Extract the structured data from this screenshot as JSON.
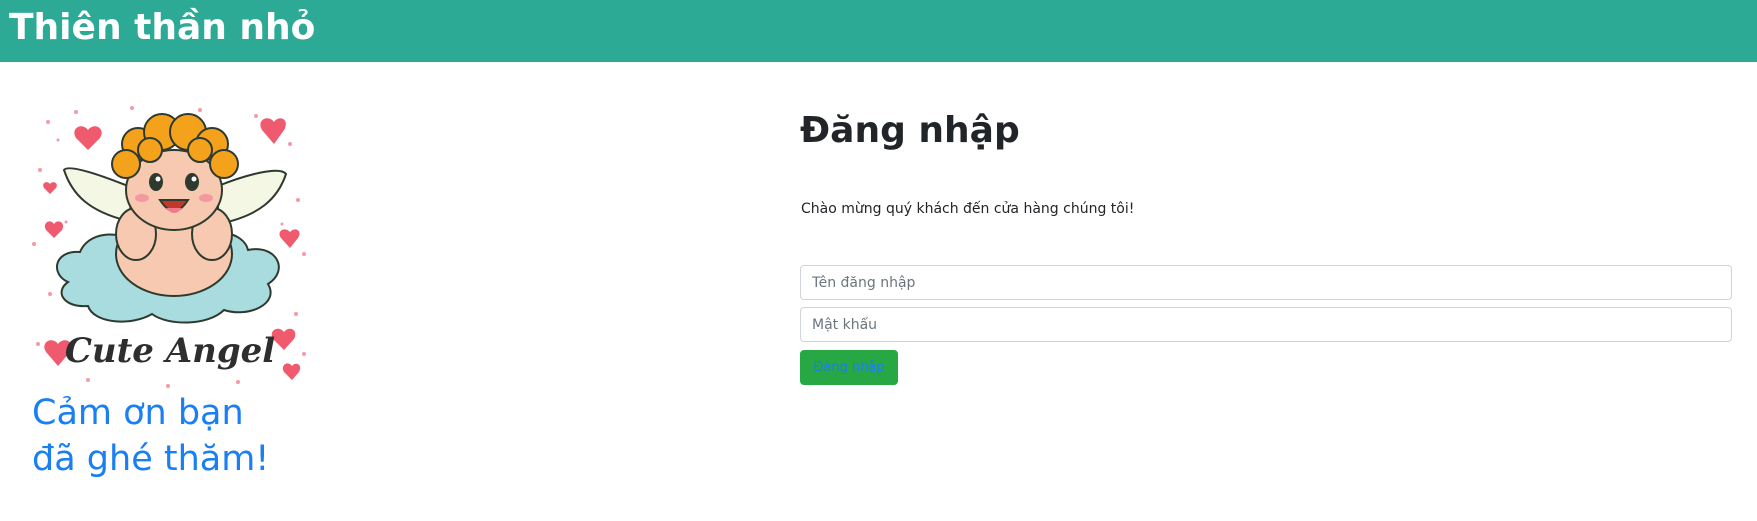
{
  "header": {
    "title": "Thiên thần nhỏ"
  },
  "sidebar": {
    "image_lettering": "Cute Angel",
    "thanks_line1": "Cảm ơn bạn",
    "thanks_line2": "đã ghé thăm!"
  },
  "login": {
    "title": "Đăng nhập",
    "welcome": "Chào mừng quý khách đến cửa hàng chúng tôi!",
    "username_placeholder": "Tên đăng nhập",
    "username_value": "",
    "password_placeholder": "Mật khẩu",
    "password_value": "",
    "submit_label": "Đăng nhập"
  },
  "colors": {
    "header_bg": "#2caa96",
    "accent_blue": "#1a7ff2",
    "button_bg": "#28a745"
  }
}
